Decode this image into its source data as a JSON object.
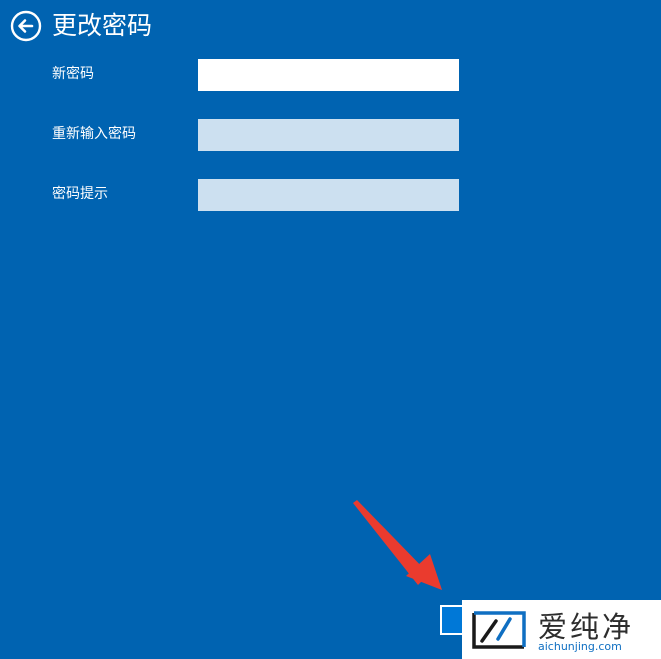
{
  "header": {
    "back_icon": "back-arrow-circle-icon",
    "title": "更改密码"
  },
  "form": {
    "fields": [
      {
        "label": "新密码",
        "value": "",
        "state": "active"
      },
      {
        "label": "重新输入密码",
        "value": "",
        "state": "disabled"
      },
      {
        "label": "密码提示",
        "value": "",
        "state": "disabled"
      }
    ]
  },
  "watermark": {
    "text": "爱纯净",
    "url": "aichunjing.com"
  },
  "colors": {
    "background": "#0063b1",
    "text": "#ffffff",
    "input_active": "#ffffff",
    "input_disabled": "#cce0f0",
    "annotation_arrow": "#ea3b2e",
    "watermark_url": "#0f6fc2"
  }
}
